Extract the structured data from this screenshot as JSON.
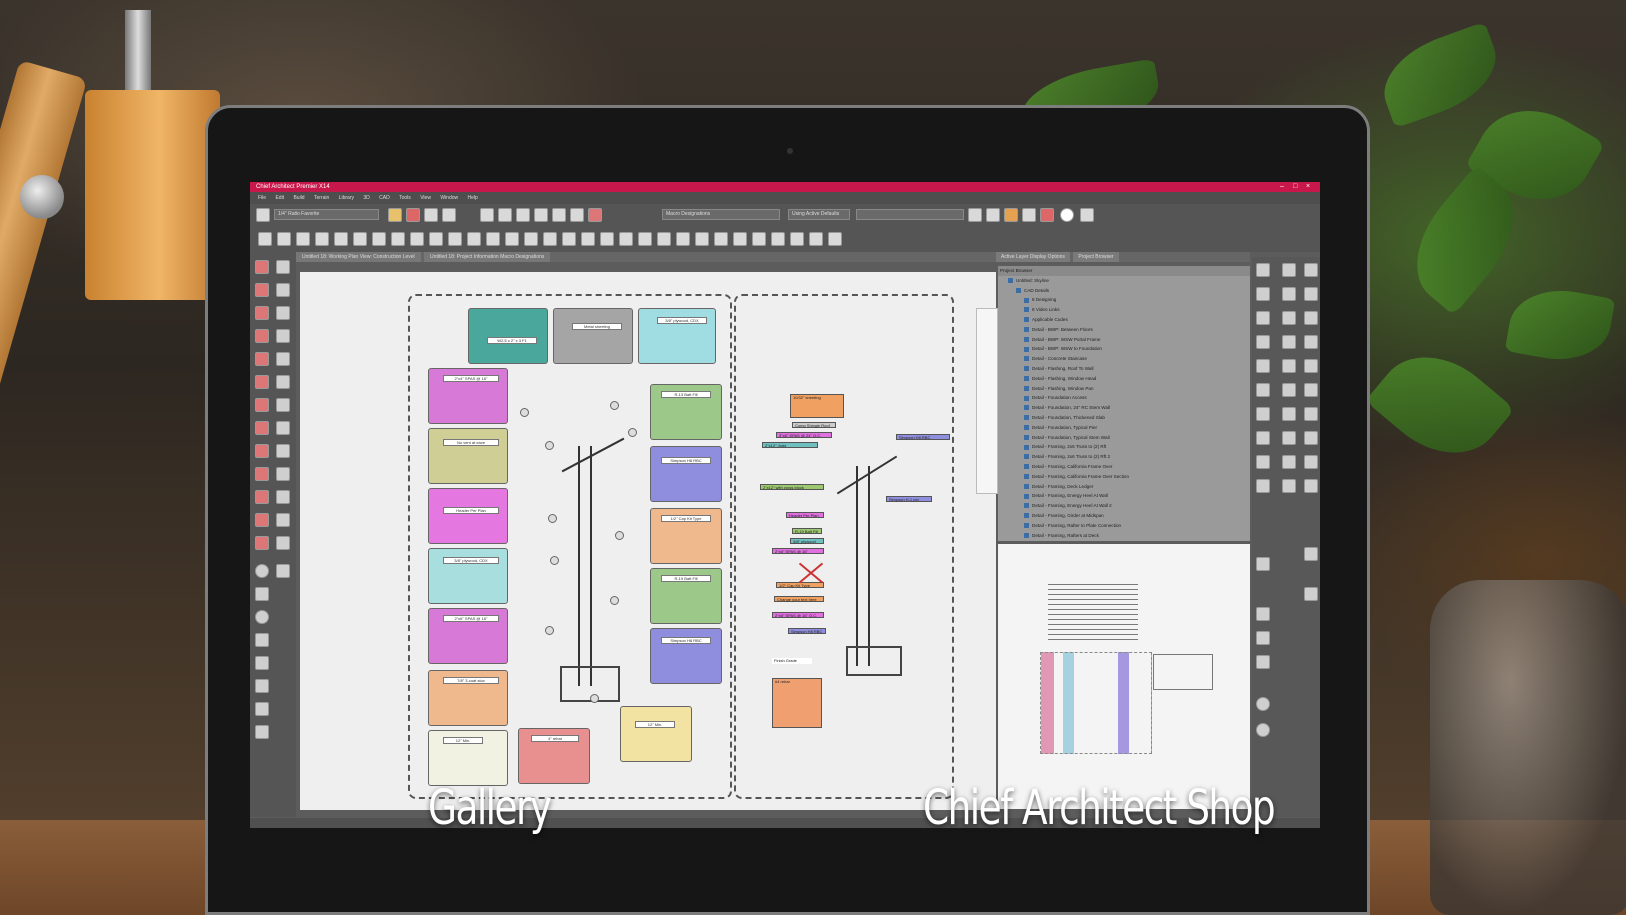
{
  "app": {
    "title": "Chief Architect Premier X14"
  },
  "toolbar": {
    "layer_select": "1/4\" Ratio Favorite",
    "macro_select": "Macro Designations",
    "defaults_select": "Using Active Defaults"
  },
  "tabs": [
    "Untitled 18: Working Plan View: Construction Level",
    "Untitled 18: Project Information Macro Designations"
  ],
  "right_panel": {
    "tabs": [
      "Active Layer Display Options",
      "Project Browser"
    ],
    "header": "Project Browser",
    "root": "Untitled: Skyline",
    "folder": "CAD Details",
    "items": [
      "8 Designing",
      "8 Video Links",
      "Applicable Codes",
      "Detail - BWP: Between Floors",
      "Detail - BWP: WSW Portal Frame",
      "Detail - BWP: WSW to Foundation",
      "Detail - Concrete Staircase",
      "Detail - Flashing, Roof To Wall",
      "Detail - Flashing, Window Head",
      "Detail - Flashing, Window Pan",
      "Detail - Foundation Access",
      "Detail - Foundation, 24\" RC Stem Wall",
      "Detail - Foundation, Thickened Slab",
      "Detail - Foundation, Typical Pier",
      "Detail - Foundation, Typical Stem Wall",
      "Detail - Framing, 2x6 Truss to (2) Rft",
      "Detail - Framing, 2x6 Truss to (2) Rft 2",
      "Detail - Framing, California Frame Over",
      "Detail - Framing, California Frame Over Section",
      "Detail - Framing, Deck Ledger",
      "Detail - Framing, Energy Heel At Wall",
      "Detail - Framing, Energy Heel At Wall 2",
      "Detail - Framing, Girder at Midspan",
      "Detail - Framing, Rafter to Plate Connection",
      "Detail - Framing, Rafters at Deck"
    ]
  },
  "drawing": {
    "left_pane_boxes": [
      {
        "label": "W2.5 x 2\" x 3 F1",
        "color": "#4aa79b"
      },
      {
        "label": "Metal sheeting",
        "color": "#a5a5a5"
      },
      {
        "label": "3/8\" plywood, CDX",
        "color": "#9fdde3"
      },
      {
        "label": "2\"x4\" SPAS @ 16\"",
        "color": "#d77ad7"
      },
      {
        "label": "R-13 Batt Fill",
        "color": "#9cc88a"
      },
      {
        "label": "No vent at eave",
        "color": "#cfcf95"
      },
      {
        "label": "Simpson H8 RBC",
        "color": "#8f8ddd"
      },
      {
        "label": "Header Per Plan",
        "color": "#e578e0"
      },
      {
        "label": "1/2\" Cap Kit Type",
        "color": "#f0b88d"
      },
      {
        "label": "3/8\" plywood, CDX",
        "color": "#a8dede"
      },
      {
        "label": "R-19 Batt Fill",
        "color": "#9cc88a"
      },
      {
        "label": "2\"x6\" SPAS @ 16\"",
        "color": "#d77ad7"
      },
      {
        "label": "Simpson H8 RBC",
        "color": "#8f8ddd"
      },
      {
        "label": "7/8\" 3-coat stuc",
        "color": "#f0b88d"
      },
      {
        "label": "4\" rebar",
        "color": "#e89090"
      },
      {
        "label": "12\" Min.",
        "color": "#f3e3a3"
      },
      {
        "label": "12\" Min.",
        "color": "#f2f2e2"
      }
    ],
    "right_pane_labels": [
      {
        "label": "10/32\" sheeting",
        "color": "#f0a060"
      },
      {
        "label": "Comp Shingle Roof",
        "color": "#cccccc"
      },
      {
        "label": "3\"x6\" SPAS @ 24\" O.C.",
        "color": "#e070e0"
      },
      {
        "label": "Simpson H8 RBC",
        "color": "#8f8ddd"
      },
      {
        "label": "2\"x12\" Joist",
        "color": "#70c0c0"
      },
      {
        "label": "2\"x12\" with cross block",
        "color": "#9cc870"
      },
      {
        "label": "Simpson H-1 per",
        "color": "#8f8ddd"
      },
      {
        "label": "Header Per Plan",
        "color": "#e070e0"
      },
      {
        "label": "R-19 Batt Fill",
        "color": "#9cc870"
      },
      {
        "label": "3/8\" plywood",
        "color": "#70c0c0"
      },
      {
        "label": "2\"x6\" SPAS @ 16\"",
        "color": "#e070e0"
      },
      {
        "label": "1/2\" Cap Kit Type",
        "color": "#f0a060"
      },
      {
        "label": "Change your text here",
        "color": "#f0a060"
      },
      {
        "label": "2\"x6\" SPAS @ 16\" O.C.",
        "color": "#e070e0"
      },
      {
        "label": "Simpson H8 RBC",
        "color": "#8f8ddd"
      },
      {
        "label": "Finish Grade",
        "color": "#ffffff"
      },
      {
        "label": "#4 rebar",
        "color": "#f0a070"
      }
    ]
  },
  "captions": {
    "left": "Gallery",
    "right": "Chief Architect Shop"
  },
  "colors": {
    "titlebar": "#c8174a",
    "app_bg": "#5c5c5c"
  }
}
